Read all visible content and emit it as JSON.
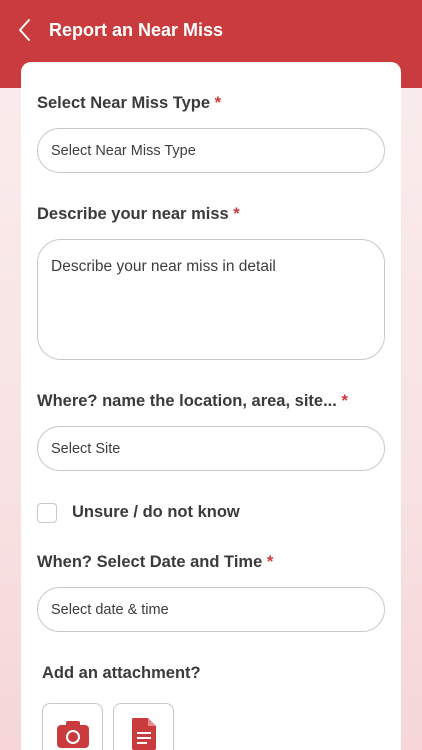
{
  "header": {
    "title": "Report an Near Miss",
    "back_icon": "chevron-left-icon"
  },
  "form": {
    "type": {
      "label": "Select Near Miss Type",
      "required_mark": "*",
      "placeholder": "Select Near Miss Type"
    },
    "description": {
      "label": "Describe your near miss",
      "required_mark": "*",
      "placeholder": "Describe your near miss in detail"
    },
    "location": {
      "label": "Where? name the location, area, site...",
      "required_mark": "*",
      "placeholder": "Select Site"
    },
    "unsure": {
      "label": "Unsure / do not know",
      "checked": false
    },
    "datetime": {
      "label": "When? Select Date and Time",
      "required_mark": "*",
      "placeholder": "Select date & time"
    },
    "attachment": {
      "label": "Add an attachment?",
      "buttons": [
        {
          "icon": "camera-icon"
        },
        {
          "icon": "document-icon"
        }
      ]
    }
  },
  "colors": {
    "brand": "#c93b3c",
    "required": "#d0373b",
    "text": "#3b3b3b",
    "border": "#c8c8c8"
  }
}
